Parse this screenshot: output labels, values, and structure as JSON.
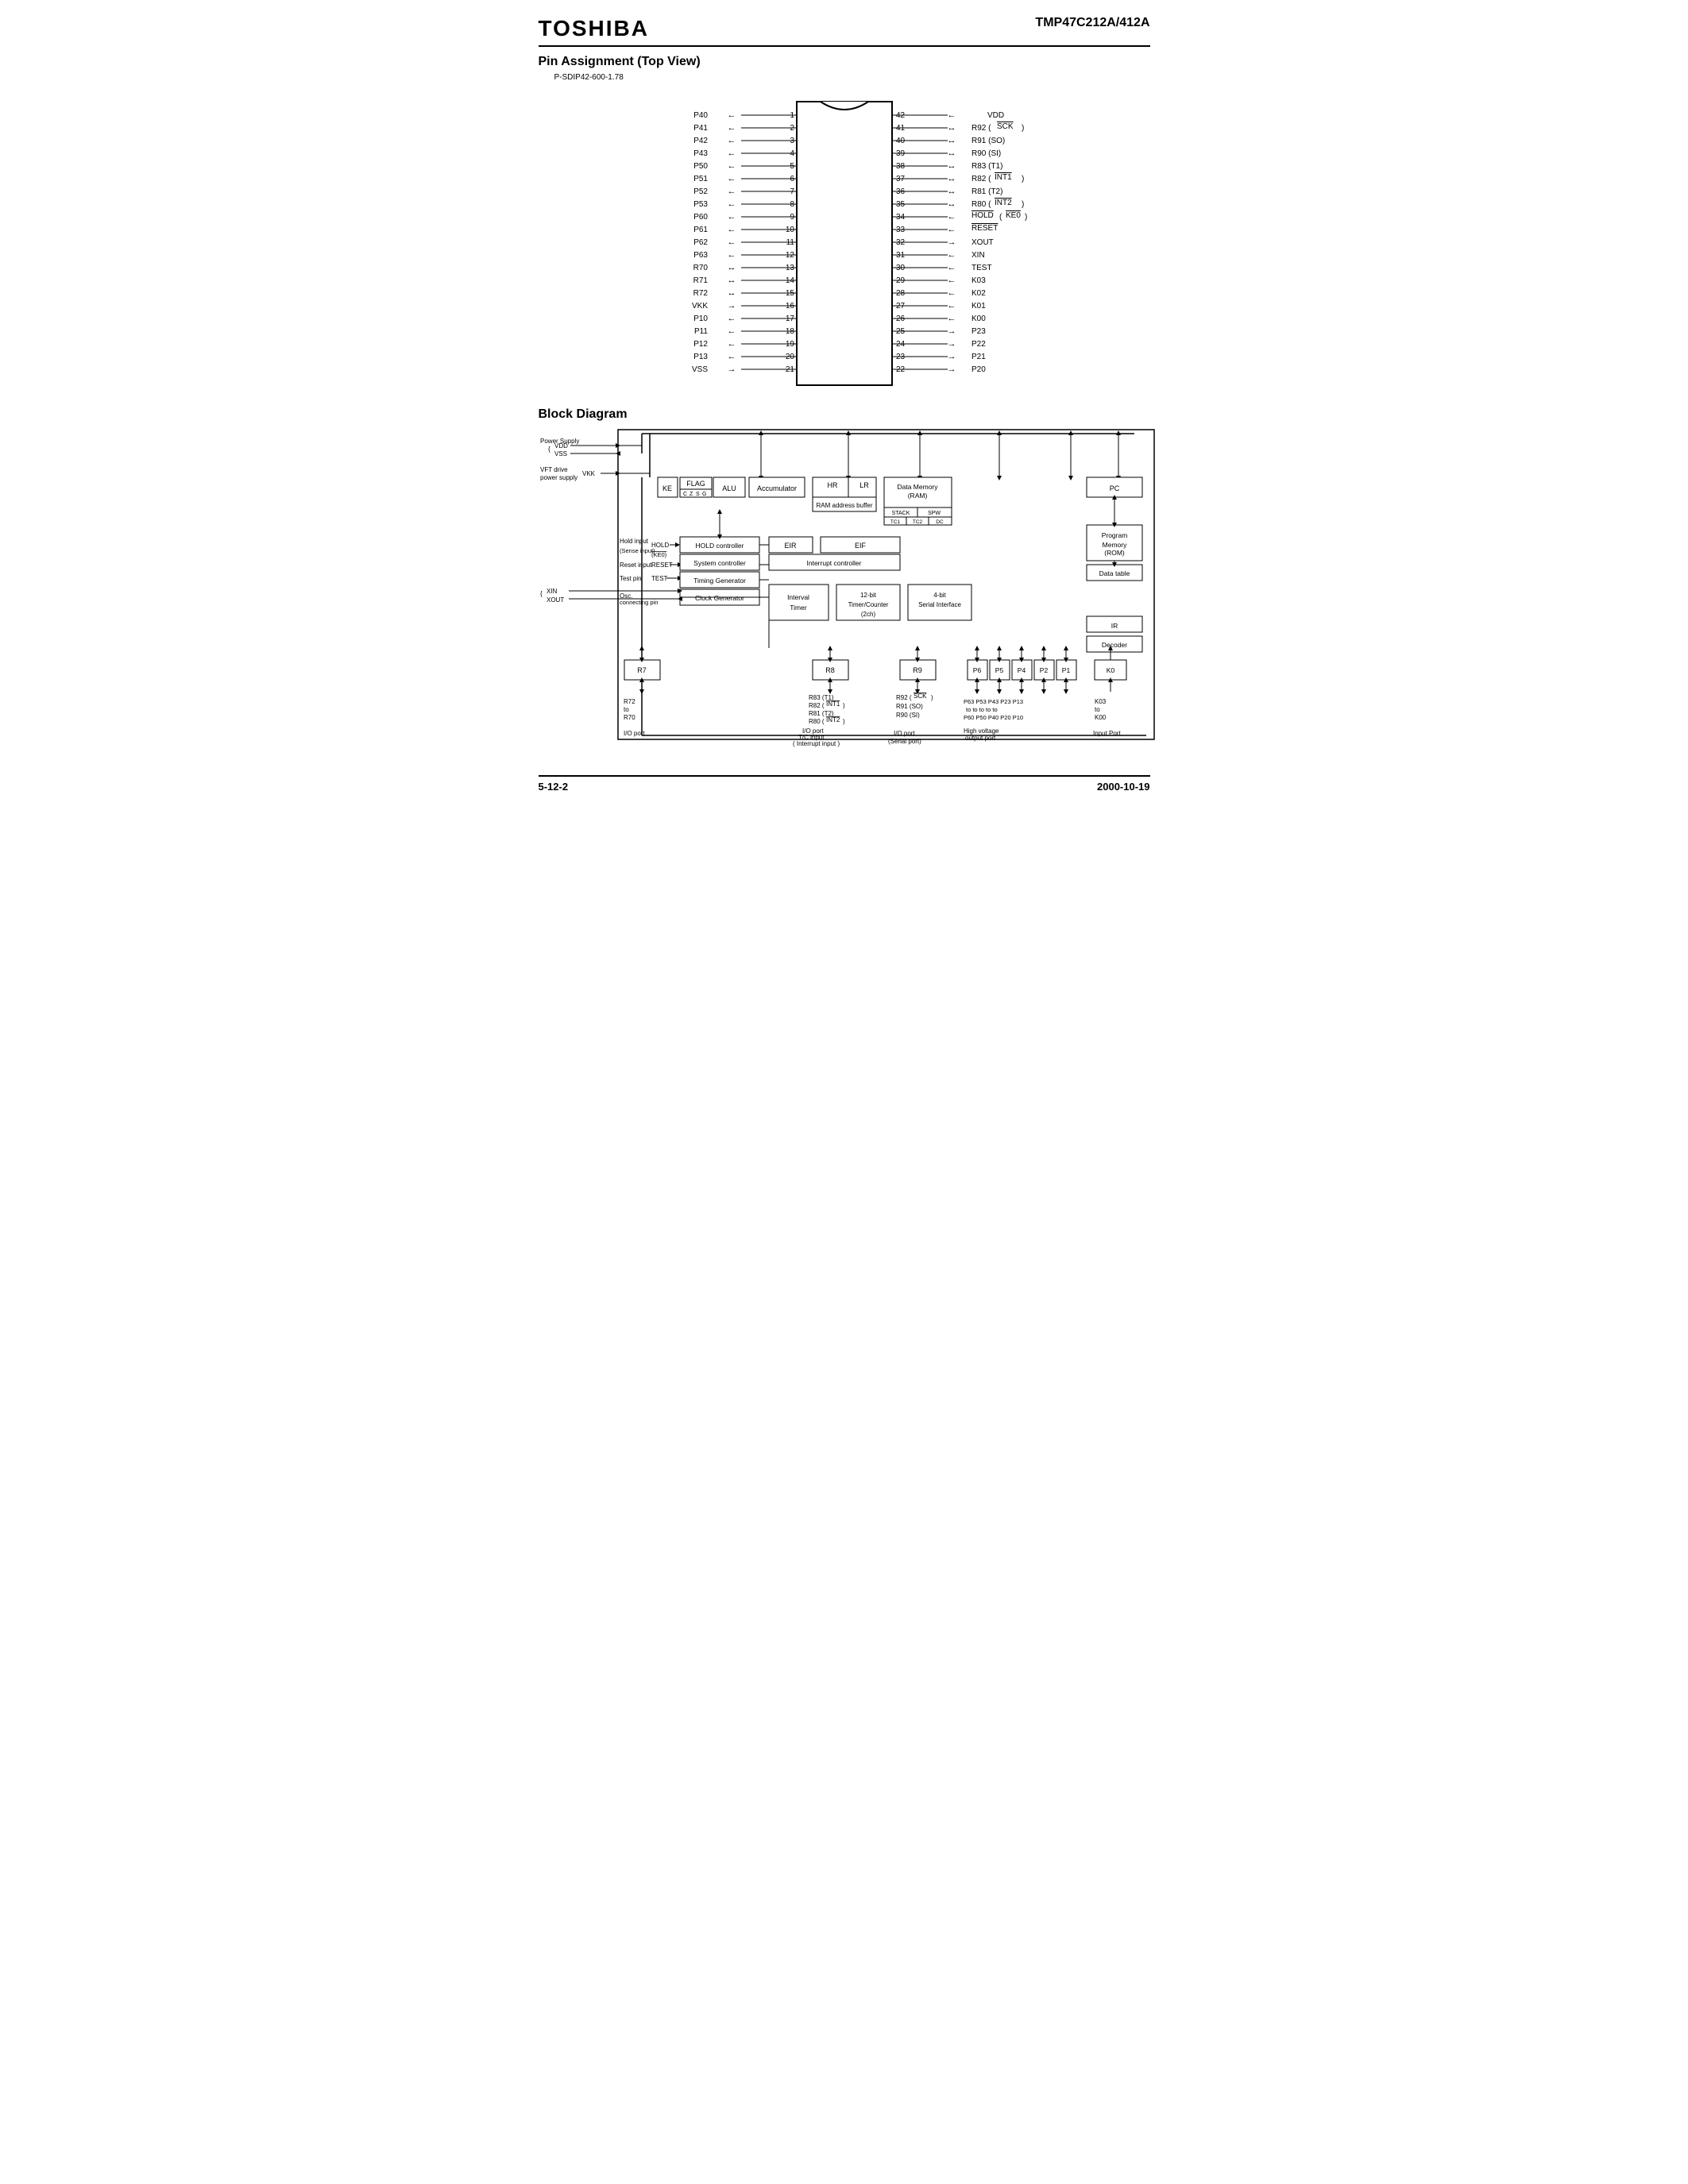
{
  "header": {
    "logo": "TOSHIBA",
    "model": "TMP47C212A/412A"
  },
  "pin_assignment": {
    "title": "Pin Assignment (Top View)",
    "package": "P-SDIP42-600-1.78",
    "pins_left": [
      {
        "num": 1,
        "label": "P40",
        "arrow": "←"
      },
      {
        "num": 2,
        "label": "P41",
        "arrow": "←"
      },
      {
        "num": 3,
        "label": "P42",
        "arrow": "←"
      },
      {
        "num": 4,
        "label": "P43",
        "arrow": "←"
      },
      {
        "num": 5,
        "label": "P50",
        "arrow": "←"
      },
      {
        "num": 6,
        "label": "P51",
        "arrow": "←"
      },
      {
        "num": 7,
        "label": "P52",
        "arrow": "←"
      },
      {
        "num": 8,
        "label": "P53",
        "arrow": "←"
      },
      {
        "num": 9,
        "label": "P60",
        "arrow": "←"
      },
      {
        "num": 10,
        "label": "P61",
        "arrow": "←"
      },
      {
        "num": 11,
        "label": "P62",
        "arrow": "←"
      },
      {
        "num": 12,
        "label": "P63",
        "arrow": "←"
      },
      {
        "num": 13,
        "label": "R70",
        "arrow": "↔"
      },
      {
        "num": 14,
        "label": "R71",
        "arrow": "↔"
      },
      {
        "num": 15,
        "label": "R72",
        "arrow": "↔"
      },
      {
        "num": 16,
        "label": "VKK",
        "arrow": "→"
      },
      {
        "num": 17,
        "label": "P10",
        "arrow": "←"
      },
      {
        "num": 18,
        "label": "P11",
        "arrow": "←"
      },
      {
        "num": 19,
        "label": "P12",
        "arrow": "←"
      },
      {
        "num": 20,
        "label": "P13",
        "arrow": "←"
      },
      {
        "num": 21,
        "label": "VSS",
        "arrow": "→"
      }
    ],
    "pins_right": [
      {
        "num": 42,
        "label": "VDD",
        "arrow": "←"
      },
      {
        "num": 41,
        "label": "R92 (SCK̄)",
        "arrow": "↔"
      },
      {
        "num": 40,
        "label": "R91 (SO)",
        "arrow": "↔"
      },
      {
        "num": 39,
        "label": "R90 (SI)",
        "arrow": "↔"
      },
      {
        "num": 38,
        "label": "R83 (T1)",
        "arrow": "↔"
      },
      {
        "num": 37,
        "label": "R82 (INT̄1̄)",
        "arrow": "↔"
      },
      {
        "num": 36,
        "label": "R81 (T2)",
        "arrow": "↔"
      },
      {
        "num": 35,
        "label": "R80 (INT̄2̄)",
        "arrow": "↔"
      },
      {
        "num": 34,
        "label": "HŌLD̄ (KĒ0̄)",
        "arrow": "←"
      },
      {
        "num": 33,
        "label": "RESET̄",
        "arrow": "←"
      },
      {
        "num": 32,
        "label": "XOUT",
        "arrow": "→"
      },
      {
        "num": 31,
        "label": "XIN",
        "arrow": "←"
      },
      {
        "num": 30,
        "label": "TEST",
        "arrow": "←"
      },
      {
        "num": 29,
        "label": "K03",
        "arrow": "←"
      },
      {
        "num": 28,
        "label": "K02",
        "arrow": "←"
      },
      {
        "num": 27,
        "label": "K01",
        "arrow": "←"
      },
      {
        "num": 26,
        "label": "K00",
        "arrow": "←"
      },
      {
        "num": 25,
        "label": "P23",
        "arrow": "→"
      },
      {
        "num": 24,
        "label": "P22",
        "arrow": "→"
      },
      {
        "num": 23,
        "label": "P21",
        "arrow": "→"
      },
      {
        "num": 22,
        "label": "P20",
        "arrow": "→"
      }
    ]
  },
  "block_diagram": {
    "title": "Block Diagram",
    "labels": {
      "power_supply": "Power Supply",
      "vdd": "VDD",
      "vss": "VSS",
      "vft_drive": "VFT drive",
      "power_supply2": "power supply",
      "vkk": "VKK",
      "ke": "KE",
      "flag": "FLAG",
      "c": "C",
      "z": "Z",
      "s": "S",
      "g": "G",
      "alu": "ALU",
      "accumulator": "Accumulator",
      "hr": "HR",
      "lr": "LR",
      "ram_addr": "RAM address buffer",
      "data_memory_ram": "Data Memory (RAM)",
      "stack": "STACK",
      "spw": "SPW",
      "tc1": "TC1",
      "tc2": "TC2",
      "dc": "DC",
      "pc": "PC",
      "program_memory": "Program Memory (ROM)",
      "hold_input": "Hold input",
      "sense_input": "(Sense input)",
      "reset_input": "Reset input",
      "test_pin": "Test pin",
      "hold_ctrl": "HOLD controller",
      "sys_ctrl": "System controller",
      "timing_gen": "Timing Generator",
      "clk_gen": "Clock Generator",
      "eir": "EIR",
      "eif": "EIF",
      "interrupt_ctrl": "Interrupt controller",
      "interval_timer": "Interval Timer",
      "timer_counter": "12-bit Timer/Counter (2ch)",
      "serial_interface": "4-bit Serial Interface",
      "ir": "IR",
      "decoder": "Decoder",
      "data_table": "Data table",
      "osc": "Osc.",
      "connecting_pin": "connecting pin",
      "xin": "XIN",
      "xout": "XOUT",
      "hold_label": "HOLD",
      "ke0_label": "(KE0)",
      "reset_label": "RESET",
      "test_label": "TEST",
      "r7": "R7",
      "r8": "R8",
      "r9": "R9",
      "p6": "P6",
      "p5": "P5",
      "p4": "P4",
      "p2": "P2",
      "p1": "P1",
      "k0": "K0",
      "r72_to_r70": "R72 to R70",
      "r83_t1": "R83 (T1)",
      "r82_int1": "R82 (INT̄1̄)",
      "r81_t2": "R81 (T2)",
      "r80_int2": "R80 (INT̄2̄)",
      "r92_sck": "R92 (SCK̄)",
      "r91_so": "R91 (SO)",
      "r90_si": "R90 (SI)",
      "p63_to_p60": "P63 to P60",
      "p53_to_p50": "P53 to P50",
      "p43_to_p40": "P43 to P40",
      "p23_to_p20": "P23 to P20",
      "p13_to_p10": "P13 to P10",
      "k03_to_k00": "K03 to K00",
      "io_port1": "I/O port",
      "io_port2": "I/O port T/C input Interrupt input",
      "io_port3": "I/O port (Serial port)",
      "high_voltage": "High voltage output port",
      "input_port": "Input Port"
    }
  },
  "footer": {
    "page": "5-12-2",
    "date": "2000-10-19"
  }
}
